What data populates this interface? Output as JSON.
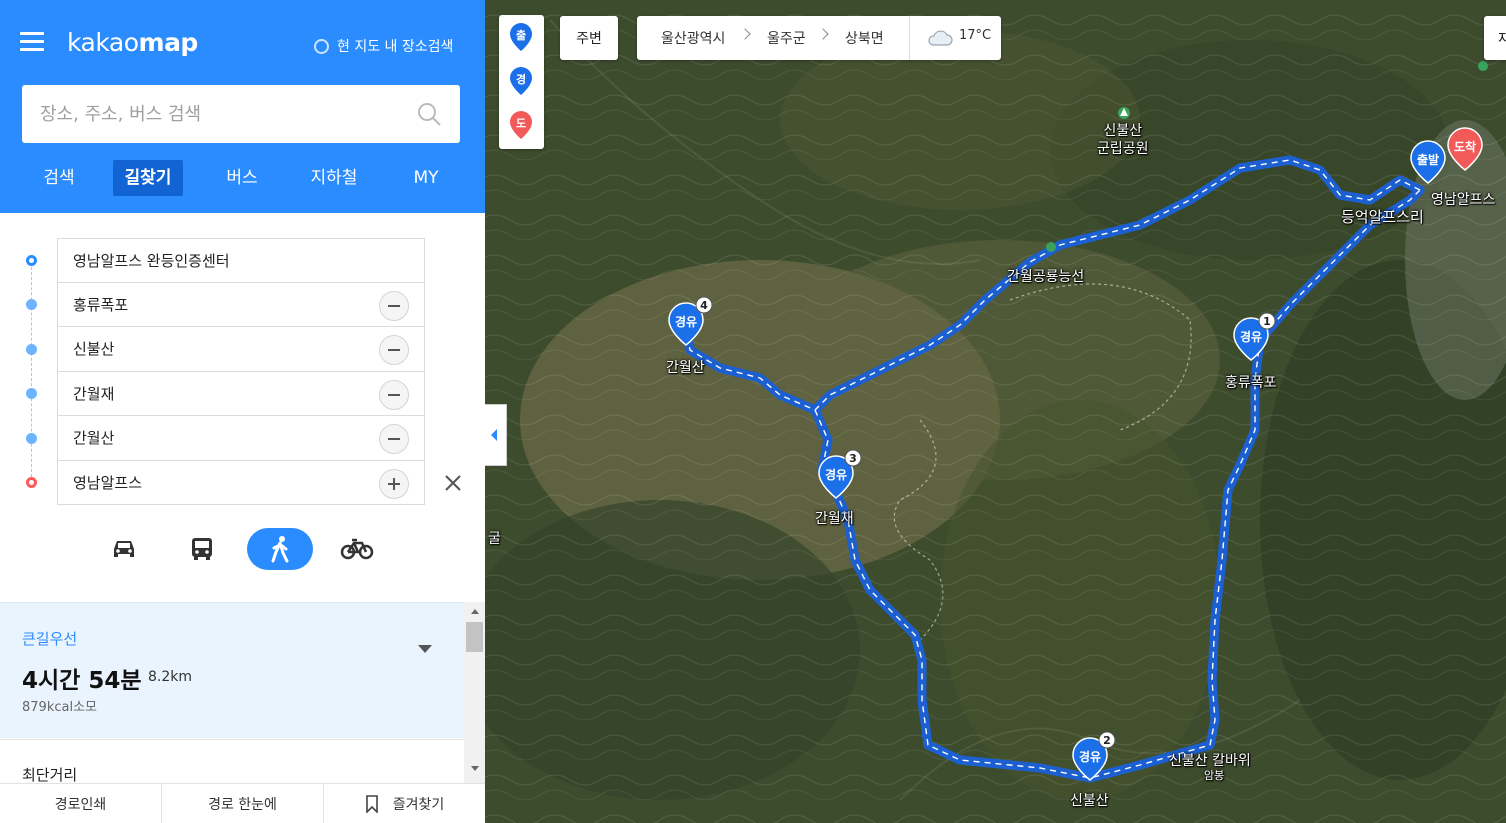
{
  "header": {
    "logo_prefix": "kakao",
    "logo_suffix": "map",
    "local_search_label": "현 지도 내 장소검색"
  },
  "search": {
    "placeholder": "장소, 주소, 버스 검색"
  },
  "tabs": [
    {
      "label": "검색",
      "active": false
    },
    {
      "label": "길찾기",
      "active": true
    },
    {
      "label": "버스",
      "active": false
    },
    {
      "label": "지하철",
      "active": false
    },
    {
      "label": "MY",
      "active": false
    }
  ],
  "waypoints": [
    {
      "label": "영남알프스 완등인증센터",
      "role": "start"
    },
    {
      "label": "홍류폭포",
      "role": "via"
    },
    {
      "label": "신불산",
      "role": "via"
    },
    {
      "label": "간월재",
      "role": "via"
    },
    {
      "label": "간월산",
      "role": "via"
    },
    {
      "label": "영남알프스",
      "role": "end"
    }
  ],
  "modes": [
    {
      "name": "car",
      "icon": "car-icon",
      "active": false
    },
    {
      "name": "bus",
      "icon": "bus-icon",
      "active": false
    },
    {
      "name": "walk",
      "icon": "walking-icon",
      "active": true
    },
    {
      "name": "bike",
      "icon": "bicycle-icon",
      "active": false
    }
  ],
  "route": {
    "type_label": "큰길우선",
    "duration": "4시간 54분",
    "distance": "8.2km",
    "calories": "879kcal소모",
    "alt_label": "최단거리"
  },
  "bottom_bar": {
    "print": "경로인쇄",
    "overview": "경로 한눈에",
    "bookmark": "즐겨찾기"
  },
  "map_controls": {
    "legend": [
      "출",
      "경",
      "도"
    ],
    "nearby": "주변",
    "breadcrumb": [
      "울산광역시",
      "울주군",
      "상북면"
    ],
    "temperature": "17°C",
    "right_partial": "지"
  },
  "map_labels": {
    "park": "신불산\n군립공원",
    "ridge": "간월공룡능선",
    "hongryu": "홍류폭포",
    "ganwoljae": "간월재",
    "ganwolsan": "간월산",
    "sinbulsan": "신불산",
    "kalbawi": "신불산 칼바위",
    "ambong": "암봉",
    "trailhead": "등억알프스리",
    "yeongnam": "영남알프스",
    "cave": "굴"
  },
  "pins": {
    "via_label": "경유",
    "start_label": "출발",
    "end_label": "도착",
    "numbers": [
      "1",
      "2",
      "3",
      "4"
    ]
  },
  "colors": {
    "brand": "#2b8cff",
    "brand_dark": "#1264d4",
    "route_line": "#4da3ff",
    "end_pin": "#ff5a5a"
  }
}
